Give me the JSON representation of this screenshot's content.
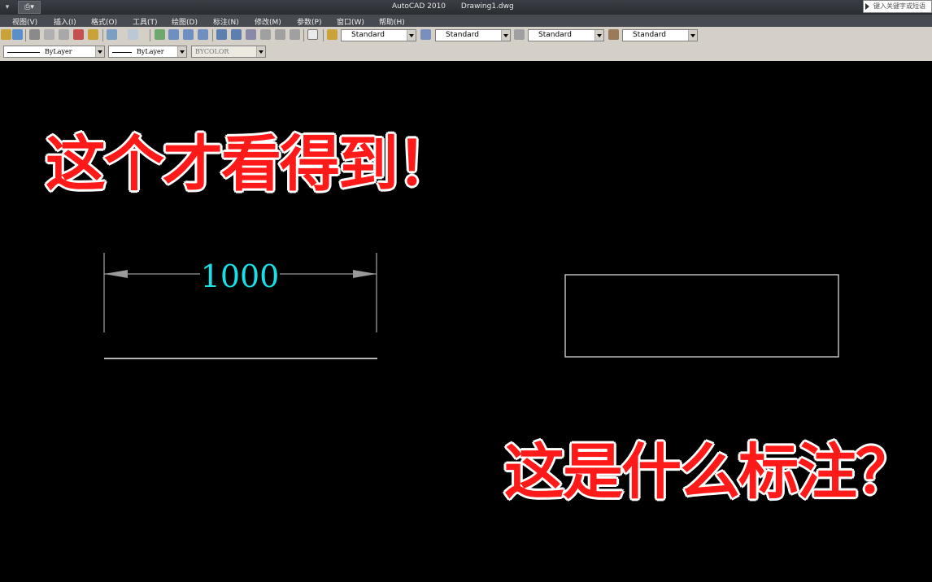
{
  "window": {
    "app_name": "AutoCAD 2010",
    "document_name": "Drawing1.dwg",
    "search_placeholder": "键入关键字或短语"
  },
  "menu": [
    {
      "label": "视图(V)"
    },
    {
      "label": "插入(I)"
    },
    {
      "label": "格式(O)"
    },
    {
      "label": "工具(T)"
    },
    {
      "label": "绘图(D)"
    },
    {
      "label": "标注(N)"
    },
    {
      "label": "修改(M)"
    },
    {
      "label": "参数(P)"
    },
    {
      "label": "窗口(W)"
    },
    {
      "label": "帮助(H)"
    }
  ],
  "styles_toolbar": {
    "text_style": "Standard",
    "dim_style": "Standard",
    "table_style": "Standard",
    "multileader_style": "Standard"
  },
  "properties_toolbar": {
    "linetype": "ByLayer",
    "lineweight": "ByLayer",
    "plotstyle": "BYCOLOR"
  },
  "drawing": {
    "dimension_text": "1000",
    "dimension_color": "#19e0e6",
    "caption_top": "这个才看得到！",
    "caption_bottom": "这是什么标注？",
    "caption_color": "#ff1a1a"
  }
}
